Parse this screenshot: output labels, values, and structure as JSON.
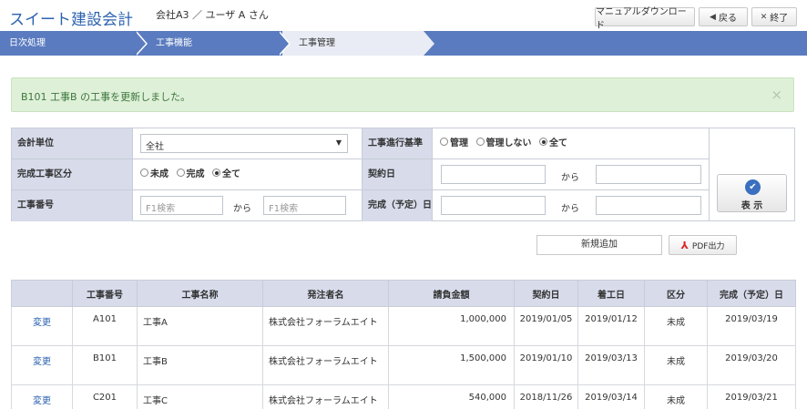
{
  "header": {
    "app_title": "スイート建設会計",
    "company_user": "会社A3 ／ ユーザ A さん",
    "manual_label": "マニュアルダウンロード",
    "back_label": "戻る",
    "exit_label": "終了"
  },
  "breadcrumb": [
    "日次処理",
    "工事機能",
    "工事管理"
  ],
  "alert": {
    "message": "B101 工事B の工事を更新しました。",
    "close": "×"
  },
  "form": {
    "unit_label": "会計単位",
    "unit_value": "全社",
    "progress_label": "工事進行基準",
    "progress_options": [
      "管理",
      "管理しない",
      "全て"
    ],
    "progress_selected": "全て",
    "complete_label": "完成工事区分",
    "complete_options": [
      "未成",
      "完成",
      "全て"
    ],
    "complete_selected": "全て",
    "contract_label": "契約日",
    "number_label": "工事番号",
    "number_placeholder": "F1検索",
    "due_label": "完成（予定）日",
    "from_text": "から",
    "show_label": "表 示"
  },
  "actions": {
    "new_label": "新規追加",
    "pdf_label": "PDF出力"
  },
  "table": {
    "headers": [
      "",
      "工事番号",
      "工事名称",
      "発注者名",
      "請負金額",
      "契約日",
      "着工日",
      "区分",
      "完成（予定）日"
    ],
    "rows": [
      {
        "action": "変更",
        "no": "A101",
        "name": "工事A",
        "client": "株式会社フォーラムエイト",
        "amount": "1,000,000",
        "contract": "2019/01/05",
        "start": "2019/01/12",
        "kubun": "未成",
        "due": "2019/03/19"
      },
      {
        "action": "変更",
        "no": "B101",
        "name": "工事B",
        "client": "株式会社フォーラムエイト",
        "amount": "1,500,000",
        "contract": "2019/01/10",
        "start": "2019/03/13",
        "kubun": "未成",
        "due": "2019/03/20"
      },
      {
        "action": "変更",
        "no": "C201",
        "name": "工事C",
        "client": "株式会社フォーラムエイト",
        "amount": "540,000",
        "contract": "2018/11/26",
        "start": "2019/03/14",
        "kubun": "未成",
        "due": "2019/03/21"
      }
    ]
  },
  "colors": {
    "brand": "#2b62b0",
    "nav": "#5a7bbf",
    "success_bg": "#dff0d8",
    "label_bg": "#d7dbea"
  },
  "icons": {
    "back": "arrow-left-icon",
    "exit": "close-icon",
    "show": "check-circle-icon",
    "pdf": "pdf-icon"
  }
}
